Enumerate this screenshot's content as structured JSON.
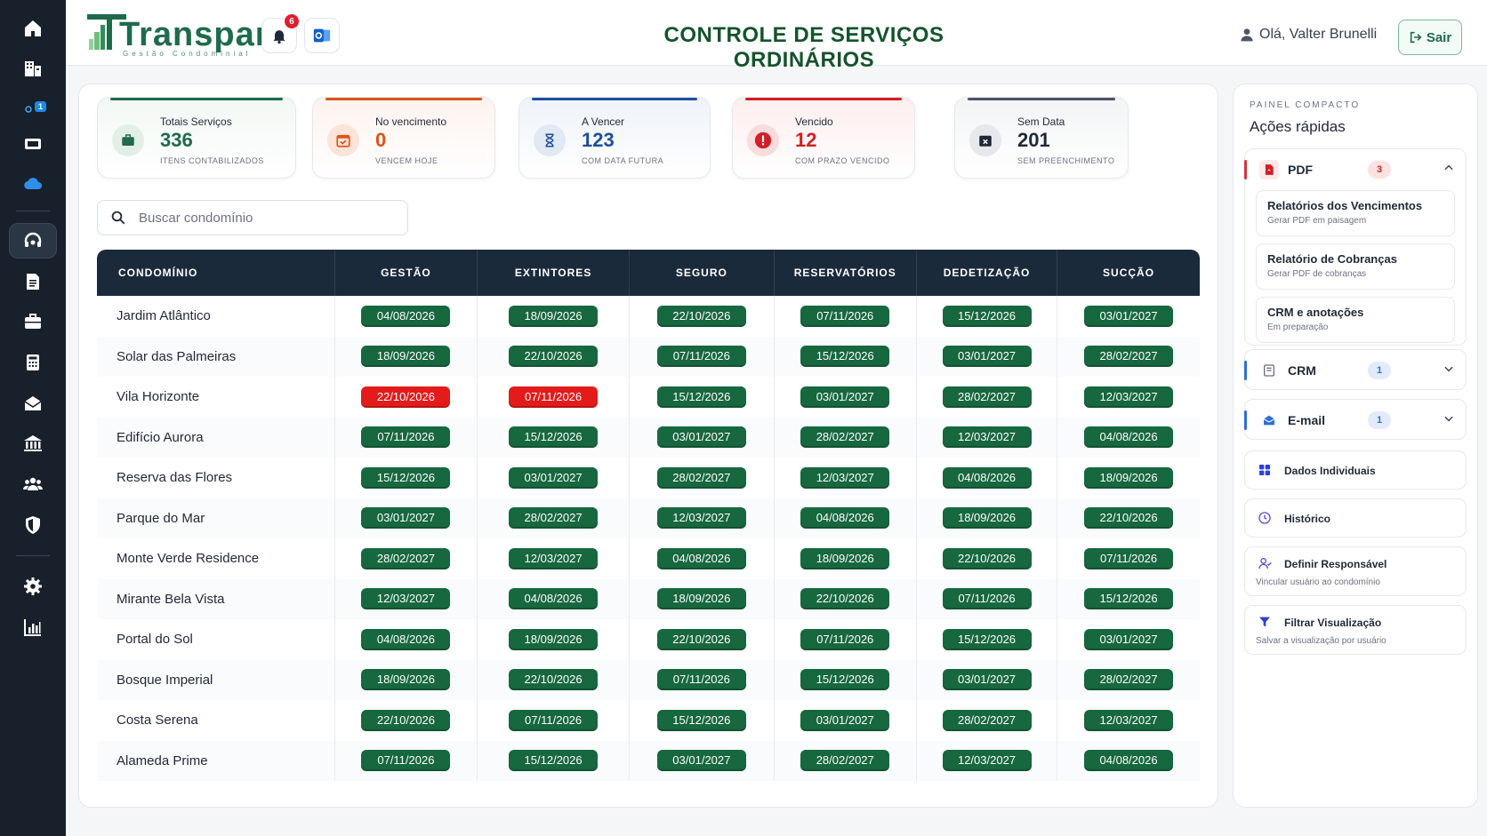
{
  "app": {
    "logo_text": "Transpare",
    "logo_sub": "Gestão Condominial",
    "title": "CONTROLE DE SERVIÇOS ORDINÁRIOS",
    "greeting": "Olá, Valter Brunelli",
    "logout_label": "Sair",
    "notification_count": "6"
  },
  "sidebar": {
    "badge": "1",
    "items": [
      "home-icon",
      "buildings-icon",
      "badge-item",
      "hardware-icon",
      "cloud-icon",
      "support-icon",
      "documents-icon",
      "briefcase-icon",
      "calculator-icon",
      "mail-open-icon",
      "bank-icon",
      "users-icon",
      "shield-icon",
      "gear-icon",
      "chart-icon"
    ]
  },
  "cards": [
    {
      "label": "Totais Serviços",
      "value": "336",
      "sub": "ITENS CONTABILIZADOS",
      "color": "#1f6b4b"
    },
    {
      "label": "No vencimento",
      "value": "0",
      "sub": "VENCEM HOJE",
      "color": "#e0521a"
    },
    {
      "label": "A Vencer",
      "value": "123",
      "sub": "COM DATA FUTURA",
      "color": "#1e4f9c"
    },
    {
      "label": "Vencido",
      "value": "12",
      "sub": "COM PRAZO VENCIDO",
      "color": "#d11f25"
    },
    {
      "label": "Sem Data",
      "value": "201",
      "sub": "SEM PREENCHIMENTO",
      "color": "#4b5563"
    }
  ],
  "search": {
    "placeholder": "Buscar condomínio"
  },
  "table": {
    "columns": [
      "CONDOMÍNIO",
      "GESTÃO",
      "EXTINTORES",
      "SEGURO",
      "RESERVATÓRIOS",
      "DEDETIZAÇÃO",
      "SUCÇÃO"
    ],
    "rows": [
      {
        "name": "Jardim Atlântico",
        "cells": [
          {
            "v": "04/08/2026",
            "s": "ok"
          },
          {
            "v": "18/09/2026",
            "s": "ok"
          },
          {
            "v": "22/10/2026",
            "s": "ok"
          },
          {
            "v": "07/11/2026",
            "s": "ok"
          },
          {
            "v": "15/12/2026",
            "s": "ok"
          },
          {
            "v": "03/01/2027",
            "s": "ok"
          }
        ]
      },
      {
        "name": "Solar das Palmeiras",
        "cells": [
          {
            "v": "18/09/2026",
            "s": "ok"
          },
          {
            "v": "22/10/2026",
            "s": "ok"
          },
          {
            "v": "07/11/2026",
            "s": "ok"
          },
          {
            "v": "15/12/2026",
            "s": "ok"
          },
          {
            "v": "03/01/2027",
            "s": "ok"
          },
          {
            "v": "28/02/2027",
            "s": "ok"
          }
        ]
      },
      {
        "name": "Vila Horizonte",
        "cells": [
          {
            "v": "22/10/2026",
            "s": "late"
          },
          {
            "v": "07/11/2026",
            "s": "late"
          },
          {
            "v": "15/12/2026",
            "s": "ok"
          },
          {
            "v": "03/01/2027",
            "s": "ok"
          },
          {
            "v": "28/02/2027",
            "s": "ok"
          },
          {
            "v": "12/03/2027",
            "s": "ok"
          }
        ]
      },
      {
        "name": "Edifício Aurora",
        "cells": [
          {
            "v": "07/11/2026",
            "s": "ok"
          },
          {
            "v": "15/12/2026",
            "s": "ok"
          },
          {
            "v": "03/01/2027",
            "s": "ok"
          },
          {
            "v": "28/02/2027",
            "s": "ok"
          },
          {
            "v": "12/03/2027",
            "s": "ok"
          },
          {
            "v": "04/08/2026",
            "s": "ok"
          }
        ]
      },
      {
        "name": "Reserva das Flores",
        "cells": [
          {
            "v": "15/12/2026",
            "s": "ok"
          },
          {
            "v": "03/01/2027",
            "s": "ok"
          },
          {
            "v": "28/02/2027",
            "s": "ok"
          },
          {
            "v": "12/03/2027",
            "s": "ok"
          },
          {
            "v": "04/08/2026",
            "s": "ok"
          },
          {
            "v": "18/09/2026",
            "s": "ok"
          }
        ]
      },
      {
        "name": "Parque do Mar",
        "cells": [
          {
            "v": "03/01/2027",
            "s": "ok"
          },
          {
            "v": "28/02/2027",
            "s": "ok"
          },
          {
            "v": "12/03/2027",
            "s": "ok"
          },
          {
            "v": "04/08/2026",
            "s": "ok"
          },
          {
            "v": "18/09/2026",
            "s": "ok"
          },
          {
            "v": "22/10/2026",
            "s": "ok"
          }
        ]
      },
      {
        "name": "Monte Verde Residence",
        "cells": [
          {
            "v": "28/02/2027",
            "s": "ok"
          },
          {
            "v": "12/03/2027",
            "s": "ok"
          },
          {
            "v": "04/08/2026",
            "s": "ok"
          },
          {
            "v": "18/09/2026",
            "s": "ok"
          },
          {
            "v": "22/10/2026",
            "s": "ok"
          },
          {
            "v": "07/11/2026",
            "s": "ok"
          }
        ]
      },
      {
        "name": "Mirante Bela Vista",
        "cells": [
          {
            "v": "12/03/2027",
            "s": "ok"
          },
          {
            "v": "04/08/2026",
            "s": "ok"
          },
          {
            "v": "18/09/2026",
            "s": "ok"
          },
          {
            "v": "22/10/2026",
            "s": "ok"
          },
          {
            "v": "07/11/2026",
            "s": "ok"
          },
          {
            "v": "15/12/2026",
            "s": "ok"
          }
        ]
      },
      {
        "name": "Portal do Sol",
        "cells": [
          {
            "v": "04/08/2026",
            "s": "ok"
          },
          {
            "v": "18/09/2026",
            "s": "ok"
          },
          {
            "v": "22/10/2026",
            "s": "ok"
          },
          {
            "v": "07/11/2026",
            "s": "ok"
          },
          {
            "v": "15/12/2026",
            "s": "ok"
          },
          {
            "v": "03/01/2027",
            "s": "ok"
          }
        ]
      },
      {
        "name": "Bosque Imperial",
        "cells": [
          {
            "v": "18/09/2026",
            "s": "ok"
          },
          {
            "v": "22/10/2026",
            "s": "ok"
          },
          {
            "v": "07/11/2026",
            "s": "ok"
          },
          {
            "v": "15/12/2026",
            "s": "ok"
          },
          {
            "v": "03/01/2027",
            "s": "ok"
          },
          {
            "v": "28/02/2027",
            "s": "ok"
          }
        ]
      },
      {
        "name": "Costa Serena",
        "cells": [
          {
            "v": "22/10/2026",
            "s": "ok"
          },
          {
            "v": "07/11/2026",
            "s": "ok"
          },
          {
            "v": "15/12/2026",
            "s": "ok"
          },
          {
            "v": "03/01/2027",
            "s": "ok"
          },
          {
            "v": "28/02/2027",
            "s": "ok"
          },
          {
            "v": "12/03/2027",
            "s": "ok"
          }
        ]
      },
      {
        "name": "Alameda Prime",
        "cells": [
          {
            "v": "07/11/2026",
            "s": "ok"
          },
          {
            "v": "15/12/2026",
            "s": "ok"
          },
          {
            "v": "03/01/2027",
            "s": "ok"
          },
          {
            "v": "28/02/2027",
            "s": "ok"
          },
          {
            "v": "12/03/2027",
            "s": "ok"
          },
          {
            "v": "04/08/2026",
            "s": "ok"
          }
        ]
      }
    ]
  },
  "panel": {
    "kicker": "PAINEL COMPACTO",
    "title": "Ações rápidas",
    "pdf": {
      "label": "PDF",
      "count": "3",
      "items": [
        {
          "title": "Relatórios dos Vencimentos",
          "desc": "Gerar PDF em paisagem"
        },
        {
          "title": "Relatório de Cobranças",
          "desc": "Gerar PDF de cobranças"
        },
        {
          "title": "CRM e anotações",
          "desc": "Em preparação"
        }
      ]
    },
    "crm": {
      "label": "CRM",
      "count": "1"
    },
    "email": {
      "label": "E-mail",
      "count": "1"
    },
    "dados": {
      "label": "Dados Individuais"
    },
    "historico": {
      "label": "Histórico"
    },
    "responsavel": {
      "label": "Definir Responsável",
      "desc": "Vincular usuário ao condomínio"
    },
    "filtro": {
      "label": "Filtrar Visualização",
      "desc": "Salvar a visualização por usuário"
    }
  },
  "colors": {
    "ok": "#17673f",
    "late": "#e31b1b",
    "navy": "#1b2a3b",
    "brand": "#1f6b4b"
  }
}
